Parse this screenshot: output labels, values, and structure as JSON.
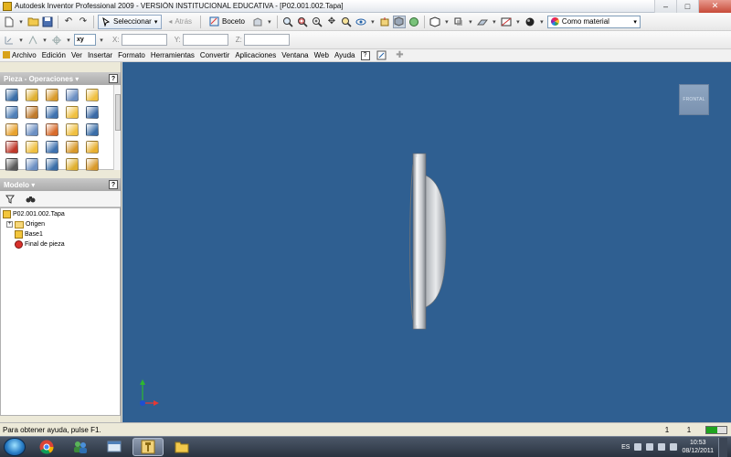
{
  "window": {
    "title": "Autodesk Inventor Professional 2009 - VERSIÓN INSTITUCIONAL EDUCATIVA - [P02.001.002.Tapa]",
    "minimize": "–",
    "maximize": "□",
    "close": "✕"
  },
  "toolbar1": {
    "select_label": "Seleccionar",
    "back_label": "Atrás",
    "sketch_label": "Boceto",
    "material_label": "Como material"
  },
  "toolbar2": {
    "plane_value": "xy",
    "x_label": "X:",
    "y_label": "Y:",
    "z_label": "Z:"
  },
  "menu": {
    "items": [
      "Archivo",
      "Edición",
      "Ver",
      "Insertar",
      "Formato",
      "Herramientas",
      "Convertir",
      "Aplicaciones",
      "Ventana",
      "Web",
      "Ayuda"
    ],
    "help": "?"
  },
  "panels": {
    "operations_title": "Pieza - Operaciones ▾",
    "model_title": "Modelo ▾",
    "help": "?"
  },
  "operations_icon_colors": [
    "#3a6ea8",
    "#e0b030",
    "#d99a2b",
    "#6b8fc3",
    "#f0c040",
    "#4f7fb8",
    "#c07a2a",
    "#3f72b0",
    "#f0c040",
    "#3b6aa6",
    "#e8a22e",
    "#6b8fc3",
    "#d96b2b",
    "#f0c040",
    "#3a6ea8",
    "#c0392b",
    "#f0c040",
    "#3f72b0",
    "#d99a2b",
    "#e8b030",
    "#5a5a5a",
    "#6b8fc3",
    "#3a6ea8",
    "#e0b030",
    "#d99a2b"
  ],
  "model_tree": {
    "root": "P02.001.002.Tapa",
    "children": [
      "Origen",
      "Base1",
      "Final de pieza"
    ]
  },
  "viewport": {
    "viewcube_label": "FRONTAL",
    "background": "#2f5f91"
  },
  "status": {
    "help_text": "Para obtener ayuda, pulse F1.",
    "count1": "1",
    "count2": "1"
  },
  "taskbar": {
    "language": "ES",
    "time": "10:53",
    "date": "08/12/2011"
  }
}
